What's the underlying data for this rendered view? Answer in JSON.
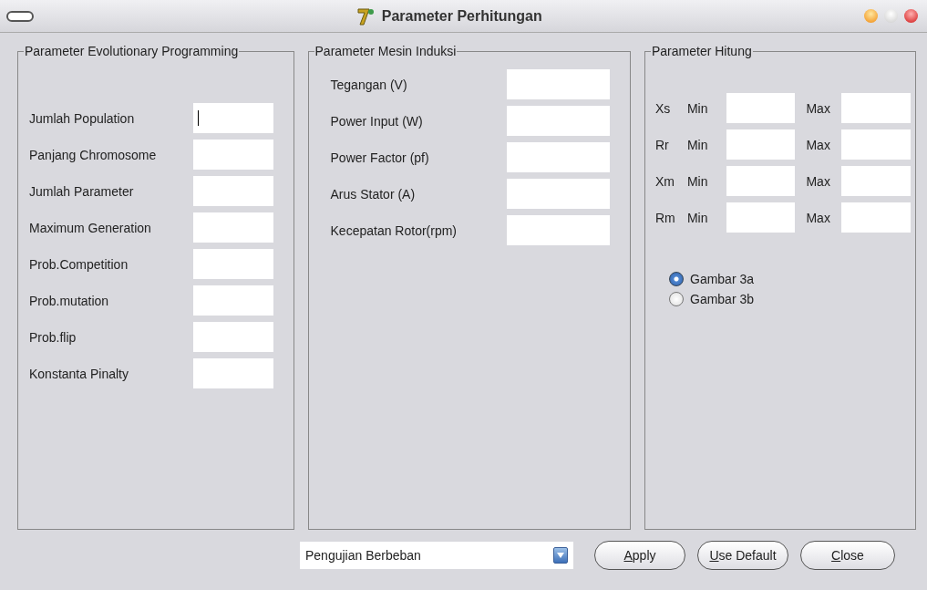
{
  "window": {
    "title": "Parameter Perhitungan"
  },
  "groups": [
    {
      "kind": "fields",
      "title": "Parameter Evolutionary Programming",
      "rows": [
        {
          "label": "Jumlah Population",
          "focused": true
        },
        {
          "label": "Panjang Chromosome",
          "focused": false
        },
        {
          "label": "Jumlah Parameter",
          "focused": false
        },
        {
          "label": "Maximum Generation",
          "focused": false
        },
        {
          "label": "Prob.Competition",
          "focused": false
        },
        {
          "label": "Prob.mutation",
          "focused": false
        },
        {
          "label": "Prob.flip",
          "focused": false
        },
        {
          "label": "Konstanta Pinalty",
          "focused": false
        }
      ]
    },
    {
      "kind": "fields",
      "title": "Parameter Mesin Induksi",
      "rows": [
        {
          "label": "Tegangan (V)",
          "focused": false
        },
        {
          "label": "Power Input (W)",
          "focused": false
        },
        {
          "label": "Power Factor (pf)",
          "focused": false
        },
        {
          "label": "Arus Stator (A)",
          "focused": false
        },
        {
          "label": "Kecepatan Rotor(rpm)",
          "focused": false
        }
      ]
    },
    {
      "kind": "ranges",
      "title": "Parameter Hitung",
      "rows": [
        {
          "name": "Xs",
          "min_label": "Min",
          "max_label": "Max"
        },
        {
          "name": "Rr",
          "min_label": "Min",
          "max_label": "Max"
        },
        {
          "name": "Xm",
          "min_label": "Min",
          "max_label": "Max"
        },
        {
          "name": "Rm",
          "min_label": "Min",
          "max_label": "Max"
        }
      ],
      "options": [
        {
          "label": "Gambar 3a",
          "selected": true
        },
        {
          "label": "Gambar 3b",
          "selected": false
        }
      ]
    }
  ],
  "dropdown": {
    "value": "Pengujian Berbeban"
  },
  "buttons": [
    {
      "label": "Apply",
      "underline_first": true
    },
    {
      "label": "Use Default",
      "underline_first": true
    },
    {
      "label": "Close",
      "underline_first": true
    }
  ]
}
